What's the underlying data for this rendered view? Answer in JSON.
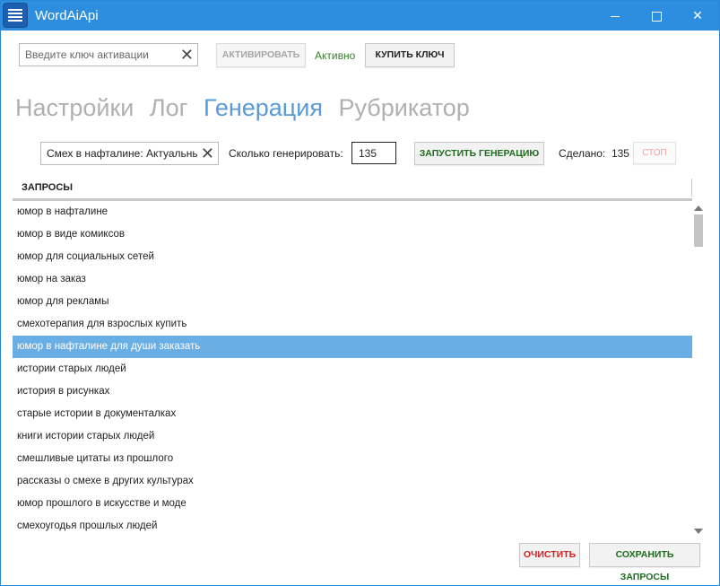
{
  "window": {
    "title": "WordAiApi",
    "minimize_glyph": "",
    "maximize_glyph": "",
    "close_glyph": "✕"
  },
  "activation": {
    "key_placeholder": "Введите ключ активации",
    "key_value": "",
    "clear_glyph": "✕",
    "activate_label": "АКТИВИРОВАТЬ",
    "status": "Активно",
    "buy_label": "КУПИТЬ КЛЮЧ"
  },
  "tabs": [
    {
      "label": "Настройки",
      "active": false
    },
    {
      "label": "Лог",
      "active": false
    },
    {
      "label": "Генерация",
      "active": true
    },
    {
      "label": "Рубрикатор",
      "active": false
    }
  ],
  "generation": {
    "query_value": "Смех в нафталине: Актуальный",
    "clear_glyph": "✕",
    "how_many_label": "Сколько генерировать:",
    "count_value": "135",
    "start_label": "ЗАПУСТИТЬ ГЕНЕРАЦИЮ",
    "done_label": "Сделано:",
    "done_value": "135",
    "stop_label": "СТОП"
  },
  "queries": {
    "header": "ЗАПРОСЫ",
    "selected_index": 6,
    "items": [
      "юмор в нафталине",
      "юмор в виде комиксов",
      "юмор для социальных сетей",
      "юмор на заказ",
      "юмор для рекламы",
      "смехотерапия для взрослых купить",
      "юмор в нафталине для души заказать",
      "истории старых людей",
      "история в рисунках",
      "старые истории в документалках",
      "книги истории старых людей",
      "смешливые цитаты из прошлого",
      "рассказы о смехе в других культурах",
      "юмор прошлого в искусстве и моде",
      "смехоугодья прошлых людей"
    ]
  },
  "footer": {
    "clear_label": "ОЧИСТИТЬ",
    "save_label": "СОХРАНИТЬ ЗАПРОСЫ"
  },
  "colors": {
    "titlebar": "#2d8ee0",
    "active_tab": "#5a9ad8",
    "selected_row": "#6aaee6",
    "status_green": "#3a7d2d",
    "danger_red": "#d42222"
  }
}
